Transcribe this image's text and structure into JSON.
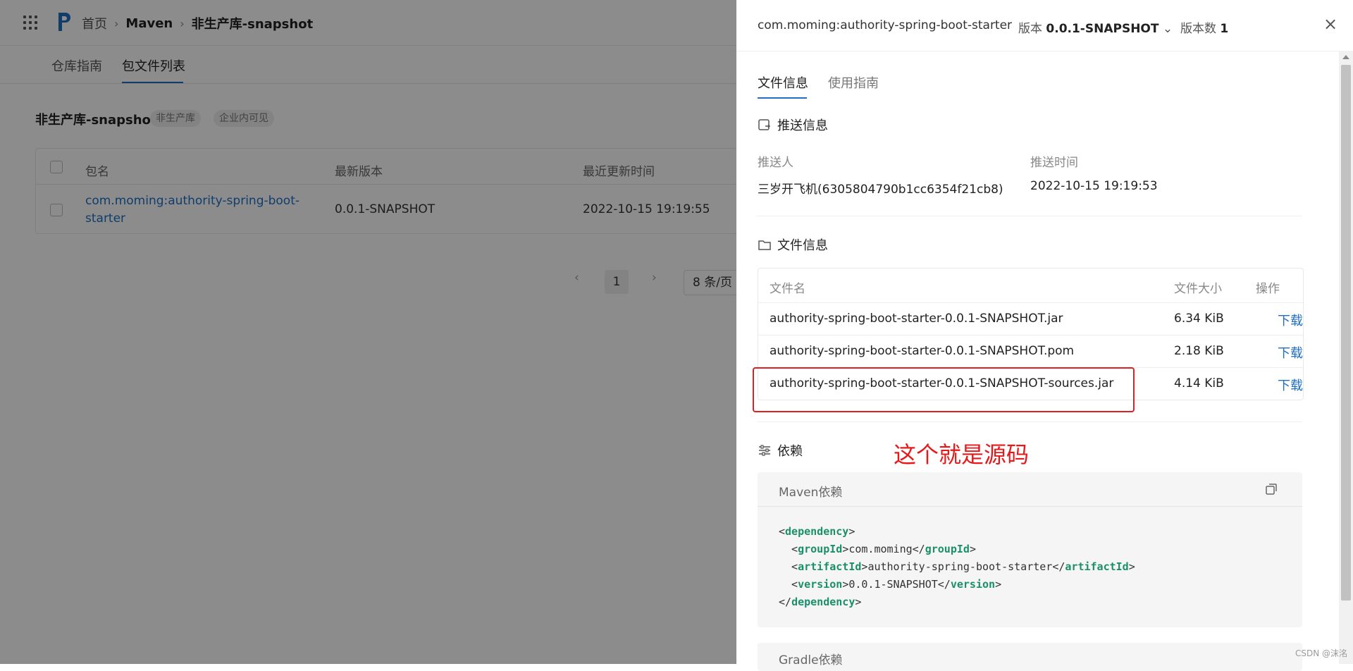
{
  "breadcrumb": {
    "home": "首页",
    "section": "Maven",
    "repo": "非生产库-snapshot"
  },
  "tabs": [
    "仓库指南",
    "包文件列表"
  ],
  "repo": {
    "name": "非生产库-snapshot",
    "tags": [
      "非生产库",
      "企业内可见"
    ]
  },
  "table": {
    "headers": [
      "包名",
      "最新版本",
      "最近更新时间"
    ],
    "rows": [
      {
        "name": "com.moming:authority-spring-boot-starter",
        "version": "0.0.1-SNAPSHOT",
        "updated": "2022-10-15 19:19:55"
      }
    ]
  },
  "pagination": {
    "prev": "‹",
    "page": "1",
    "next": "›",
    "page_size": "8 条/页"
  },
  "drawer": {
    "title": "com.moming:authority-spring-boot-starter",
    "version_label": "版本",
    "version_value": "0.0.1-SNAPSHOT",
    "version_chevron": "⌄",
    "count_label": "版本数",
    "count_value": "1",
    "close": "×",
    "tabs": [
      "文件信息",
      "使用指南"
    ],
    "push_section": "推送信息",
    "pusher_label": "推送人",
    "pusher_value": "三岁开飞机(6305804790b1cc6354f21cb8)",
    "push_time_label": "推送时间",
    "push_time_value": "2022-10-15 19:19:53",
    "file_section": "文件信息",
    "file_headers": [
      "文件名",
      "文件大小",
      "操作"
    ],
    "files": [
      {
        "name": "authority-spring-boot-starter-0.0.1-SNAPSHOT.jar",
        "size": "6.34 KiB",
        "action": "下载"
      },
      {
        "name": "authority-spring-boot-starter-0.0.1-SNAPSHOT.pom",
        "size": "2.18 KiB",
        "action": "下载"
      },
      {
        "name": "authority-spring-boot-starter-0.0.1-SNAPSHOT-sources.jar",
        "size": "4.14 KiB",
        "action": "下载"
      }
    ],
    "dep_section": "依赖",
    "maven_title": "Maven依赖",
    "code": {
      "dependency": "dependency",
      "groupId_tag": "groupId",
      "groupId": "com.moming",
      "artifactId_tag": "artifactId",
      "artifactId": "authority-spring-boot-starter",
      "version_tag": "version",
      "version": "0.0.1-SNAPSHOT"
    },
    "gradle_title": "Gradle依赖"
  },
  "annotation": "这个就是源码",
  "watermark": "CSDN @沫洺",
  "colors": {
    "accent": "#1f6fc4",
    "annotation": "#e02020",
    "xml_tag": "#1a8f6a"
  }
}
